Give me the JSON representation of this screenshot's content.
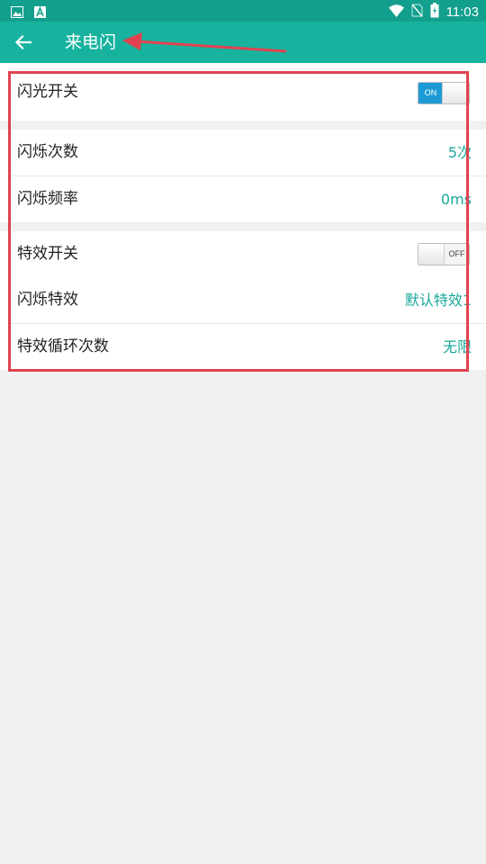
{
  "status_bar": {
    "time": "11:03",
    "icons": [
      "image-icon",
      "a-notification-icon",
      "wifi-icon",
      "no-sim-icon",
      "battery-charging-icon"
    ]
  },
  "app_bar": {
    "title": "来电闪",
    "back_icon": "arrow-back-icon"
  },
  "settings": {
    "flash_switch": {
      "label": "闪光开关",
      "state": "ON",
      "on_text": "ON"
    },
    "flash_count": {
      "label": "闪烁次数",
      "value": "5次"
    },
    "flash_frequency": {
      "label": "闪烁频率",
      "value": "0ms"
    },
    "effect_switch": {
      "label": "特效开关",
      "state": "OFF",
      "off_text": "OFF"
    },
    "flash_effect": {
      "label": "闪烁特效",
      "value": "默认特效1"
    },
    "effect_loop_count": {
      "label": "特效循环次数",
      "value": "无限"
    }
  },
  "colors": {
    "status_bar": "#139f8d",
    "app_bar": "#17b39e",
    "value_text": "#17a89a",
    "toggle_on": "#1e9bd6",
    "annotation": "#e0434f"
  }
}
